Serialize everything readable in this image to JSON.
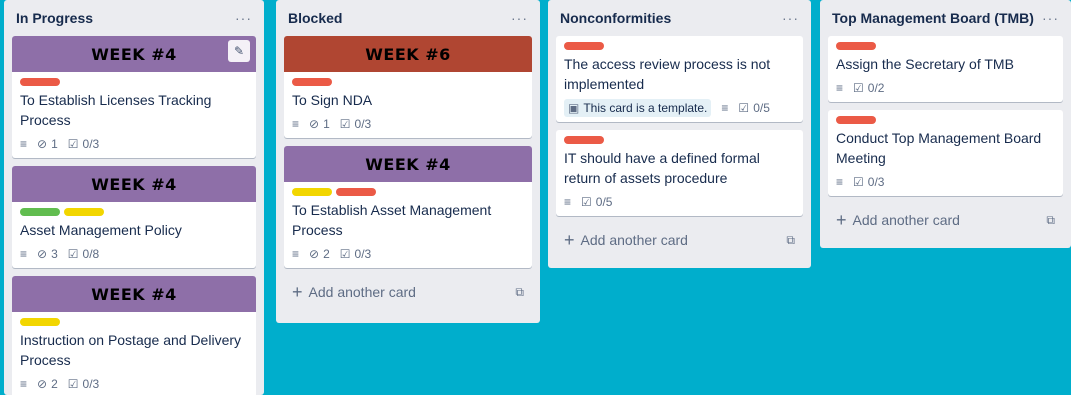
{
  "board": {
    "lists": [
      {
        "title": "In Progress",
        "menu": "···",
        "cards": [
          {
            "cover": "WEEK #4",
            "cover_color": "#8e6fa8",
            "labels": [
              "#eb5a46"
            ],
            "title": "To Establish Licenses Tracking Process",
            "attachments": "1",
            "checklist": "0/3",
            "edit_icon": "✎"
          },
          {
            "cover": "WEEK #4",
            "cover_color": "#8e6fa8",
            "labels": [
              "#61bd4f",
              "#f2d600"
            ],
            "title": "Asset Management Policy",
            "attachments": "3",
            "checklist": "0/8"
          },
          {
            "cover": "WEEK #4",
            "cover_color": "#8e6fa8",
            "labels": [
              "#f2d600"
            ],
            "title": "Instruction on Postage and Delivery Process",
            "attachments": "2",
            "checklist": "0/3"
          }
        ]
      },
      {
        "title": "Blocked",
        "menu": "···",
        "cards": [
          {
            "cover": "WEEK #6",
            "cover_color": "#b04632",
            "labels": [
              "#eb5a46"
            ],
            "title": "To Sign NDA",
            "attachments": "1",
            "checklist": "0/3"
          },
          {
            "cover": "WEEK #4",
            "cover_color": "#8e6fa8",
            "labels": [
              "#f2d600",
              "#eb5a46"
            ],
            "title": "To Establish Asset Management Process",
            "attachments": "2",
            "checklist": "0/3"
          }
        ],
        "add_card": "Add another card"
      },
      {
        "title": "Nonconformities",
        "menu": "···",
        "cards": [
          {
            "labels": [
              "#eb5a46"
            ],
            "title": "The access review process is not implemented",
            "template": "This card is a template.",
            "checklist": "0/5"
          },
          {
            "labels": [
              "#eb5a46"
            ],
            "title": "IT should have a defined formal return of assets procedure",
            "checklist": "0/5"
          }
        ],
        "add_card": "Add another card"
      },
      {
        "title": "Top Management Board (TMB)",
        "menu": "···",
        "cards": [
          {
            "labels": [
              "#eb5a46"
            ],
            "title": "Assign the Secretary of TMB",
            "checklist": "0/2"
          },
          {
            "labels": [
              "#eb5a46"
            ],
            "title": "Conduct Top Management Board Meeting",
            "checklist": "0/3"
          }
        ],
        "add_card": "Add another card"
      }
    ]
  },
  "icons": {
    "description": "≡",
    "attachment": "⊘",
    "checklist": "☑",
    "template": "▣",
    "plus": "+",
    "card_template": "⧉"
  }
}
